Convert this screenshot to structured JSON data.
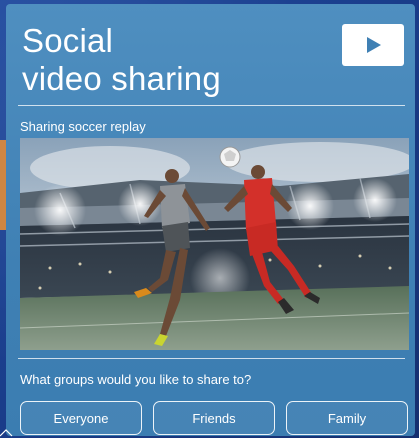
{
  "card": {
    "title": "Social\nvideo sharing",
    "play_icon": "play-icon",
    "subtitle": "Sharing soccer replay",
    "question": "What groups would you like to share to?",
    "groups": [
      {
        "label": "Everyone"
      },
      {
        "label": "Friends"
      },
      {
        "label": "Family"
      }
    ]
  },
  "colors": {
    "card_bg": "#4a8bbd",
    "page_bg": "#1f3f86",
    "accent_orange": "#e18d3a",
    "text": "#ffffff"
  }
}
